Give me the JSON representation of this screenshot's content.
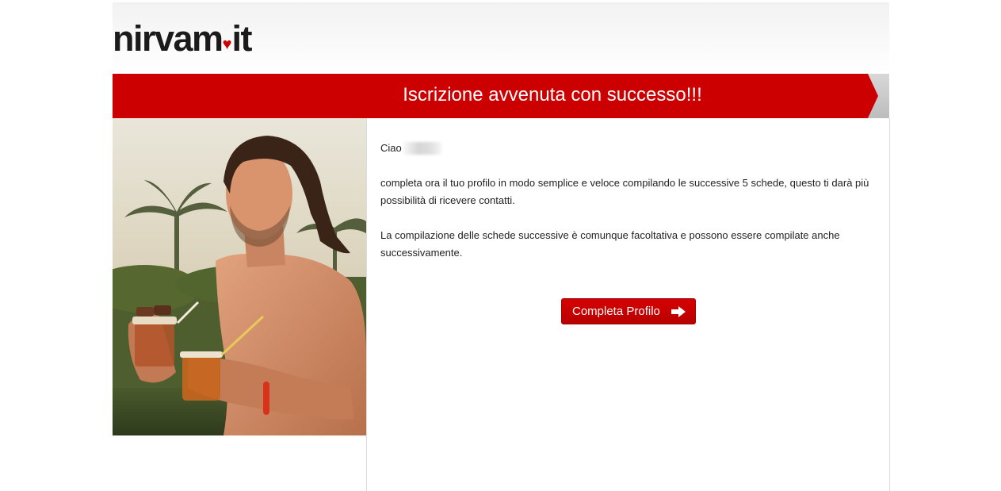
{
  "header": {
    "logo_main": "nirvam",
    "logo_dot": "♥",
    "logo_tld": "it"
  },
  "banner": {
    "title": "Iscrizione avvenuta con successo!!!"
  },
  "photo": {
    "alt": "Uomo sorridente con bevande"
  },
  "content": {
    "greeting": "Ciao",
    "paragraph_1": "completa ora il tuo profilo in modo semplice e veloce compilando le successive 5 schede, questo ti darà più possibilità di ricevere contatti.",
    "paragraph_2": "La compilazione delle schede successive è comunque facoltativa e possono essere compilate anche successivamente.",
    "button_label": "Completa Profilo"
  },
  "colors": {
    "brand_red": "#cc0000",
    "text": "#222222"
  }
}
